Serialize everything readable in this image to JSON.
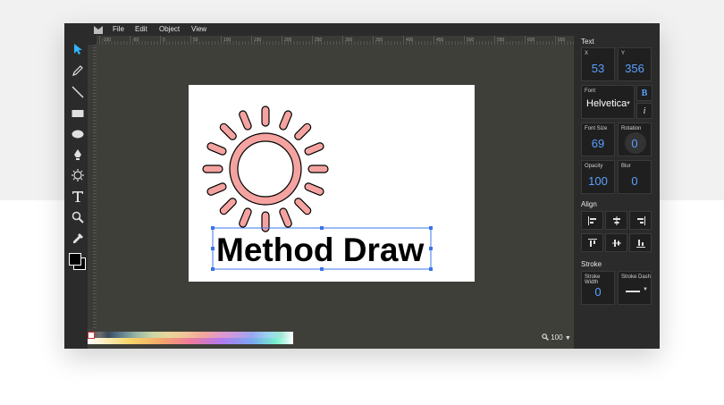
{
  "menu": {
    "file": "File",
    "edit": "Edit",
    "object": "Object",
    "view": "View"
  },
  "ruler": {
    "ticks": [
      "-100",
      "-50",
      "0",
      "50",
      "100",
      "150",
      "200",
      "250",
      "300",
      "350",
      "400",
      "450",
      "500",
      "550",
      "600",
      "650"
    ]
  },
  "canvas": {
    "text": "Method Draw",
    "sun_color": "#f4a3a0"
  },
  "bottom": {
    "zoom": "100"
  },
  "panel": {
    "text_heading": "Text",
    "x_label": "X",
    "x_value": "53",
    "y_label": "Y",
    "y_value": "356",
    "font_label": "Font",
    "font_value": "Helvetica",
    "bold_label": "B",
    "italic_label": "i",
    "font_size_label": "Font Size",
    "font_size_value": "69",
    "rotation_label": "Rotation",
    "rotation_value": "0",
    "opacity_label": "Opacity",
    "opacity_value": "100",
    "blur_label": "Blur",
    "blur_value": "0",
    "align_heading": "Align",
    "stroke_heading": "Stroke",
    "stroke_width_label": "Stroke Width",
    "stroke_width_value": "0",
    "stroke_dash_label": "Stroke Dash"
  },
  "colors": {
    "accent": "#5aa0ff",
    "selection": "#3b74e8"
  },
  "icons": [
    "select-icon",
    "pencil-icon",
    "line-icon",
    "rect-icon",
    "ellipse-icon",
    "pen-icon",
    "shape-library-icon",
    "text-icon",
    "zoom-icon",
    "eyedropper-icon"
  ]
}
